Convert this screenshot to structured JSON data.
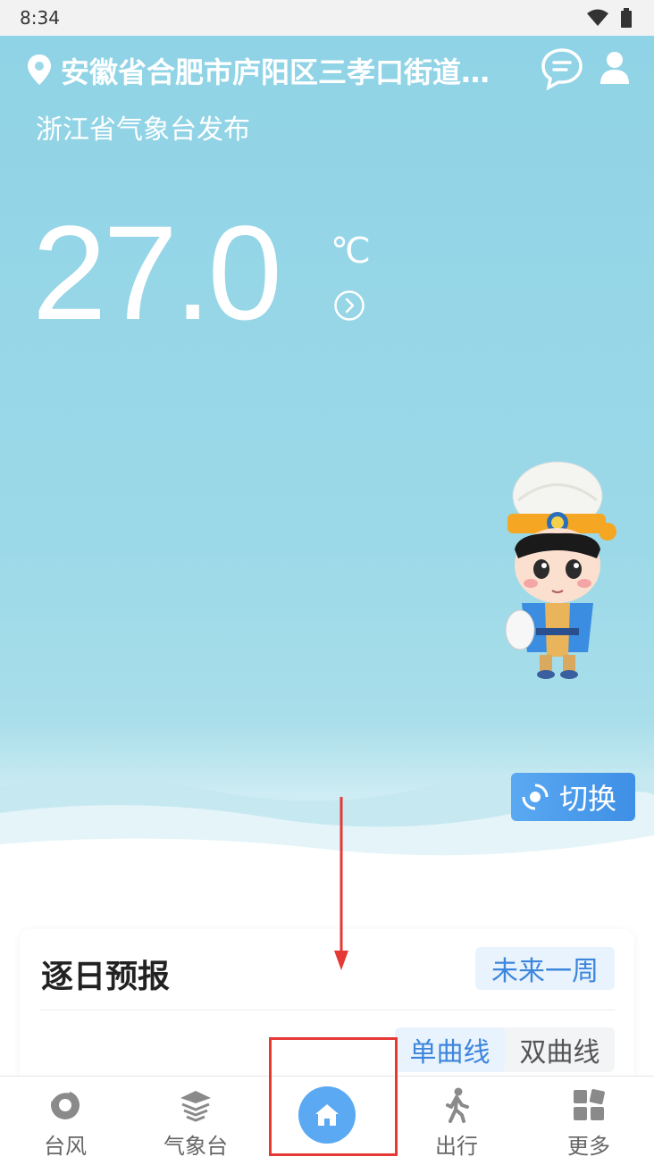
{
  "status_bar": {
    "time": "8:34"
  },
  "header": {
    "location": "安徽省合肥市庐阳区三孝口街道…",
    "publisher": "浙江省气象台发布"
  },
  "current": {
    "temperature": "27.0",
    "unit": "℃"
  },
  "switch_label": "切换",
  "forecast": {
    "title": "逐日预报",
    "period_tag": "未来一周",
    "toggles": [
      "单曲线",
      "双曲线"
    ],
    "active_toggle": "单曲线"
  },
  "nav": {
    "items": [
      {
        "label": "台风",
        "icon": "typhoon-icon"
      },
      {
        "label": "气象台",
        "icon": "observatory-icon"
      },
      {
        "label": "",
        "icon": "home-icon"
      },
      {
        "label": "出行",
        "icon": "walk-icon"
      },
      {
        "label": "更多",
        "icon": "grid-icon"
      }
    ]
  },
  "colors": {
    "sky": "#9cd9e8",
    "accent": "#3d86dc",
    "annotation": "#e53935"
  }
}
